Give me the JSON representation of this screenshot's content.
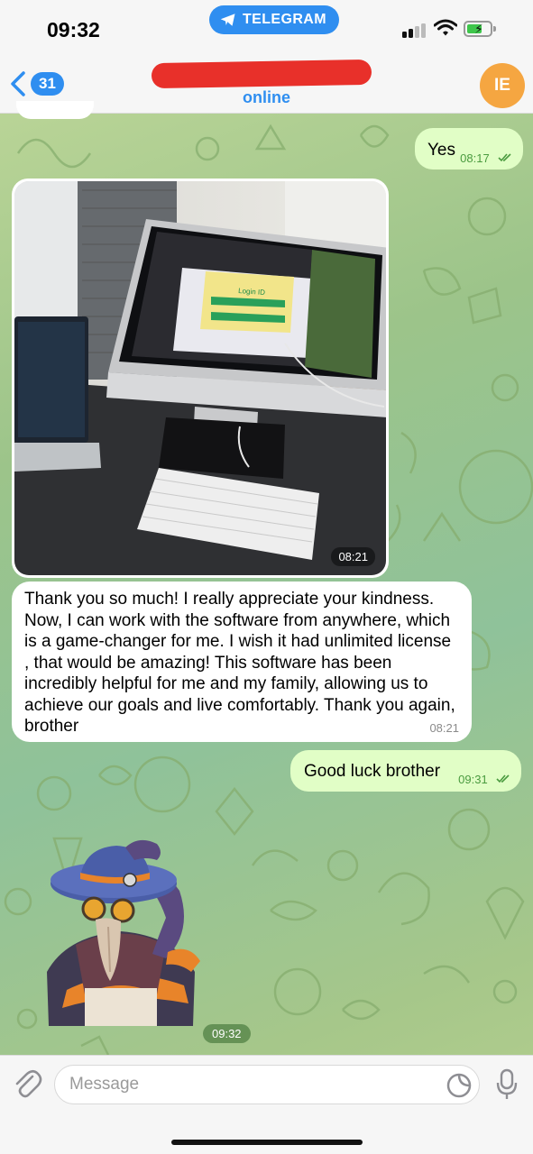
{
  "status_bar": {
    "time": "09:32",
    "app_pill": "TELEGRAM"
  },
  "header": {
    "back_count": "31",
    "contact_status": "online",
    "avatar_initials": "IE"
  },
  "messages": [
    {
      "direction": "out",
      "text": "Yes",
      "time": "08:17",
      "read": true
    },
    {
      "direction": "in",
      "type": "photo",
      "time": "08:21",
      "photo_screen_text": "Login ID"
    },
    {
      "direction": "in",
      "text": "Thank you so much! I really appreciate your kindness. Now, I can work with the software from anywhere, which is a game-changer for me. I wish it had unlimited license , that would be amazing! This software has been incredibly helpful for me and my family, allowing us to achieve our goals and live comfortably. Thank you again, brother",
      "time": "08:21"
    },
    {
      "direction": "out",
      "text": "Good luck brother",
      "time": "09:31",
      "read": true
    },
    {
      "direction": "in",
      "type": "sticker",
      "time": "09:32"
    }
  ],
  "composer": {
    "placeholder": "Message"
  },
  "icons": {
    "back": "chevron-left-icon",
    "telegram": "telegram-plane-icon",
    "attach": "paperclip-icon",
    "sticker": "sticker-icon",
    "mic": "microphone-icon"
  },
  "colors": {
    "accent": "#2f8ef0",
    "outgoing_bubble": "#e1fec6",
    "incoming_bubble": "#ffffff",
    "avatar": "#f5a641",
    "read_check": "#4a9b3f"
  }
}
